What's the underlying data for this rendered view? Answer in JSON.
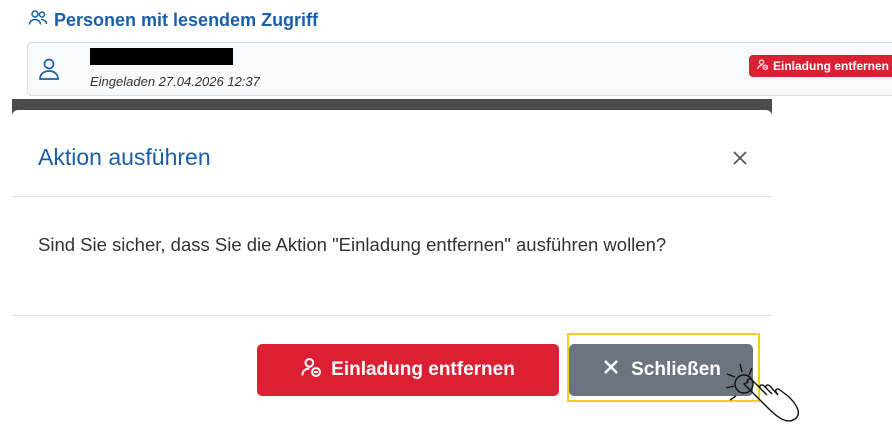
{
  "section": {
    "title": "Personen mit lesendem Zugriff",
    "icon": "users-icon"
  },
  "person": {
    "meta": "Eingeladen 27.04.2026 12:37",
    "icon": "user-icon",
    "remove_badge_label": "Einladung entfernen"
  },
  "modal": {
    "title": "Aktion ausführen",
    "body": "Sind Sie sicher, dass Sie die Aktion \"Einladung entfernen\" ausführen wollen?",
    "confirm_label": "Einladung entfernen",
    "close_label": "Schließen"
  },
  "colors": {
    "primary_text": "#1a5fa8",
    "danger": "#dc2034",
    "secondary": "#6c757d",
    "highlight": "#f2cf1b"
  }
}
